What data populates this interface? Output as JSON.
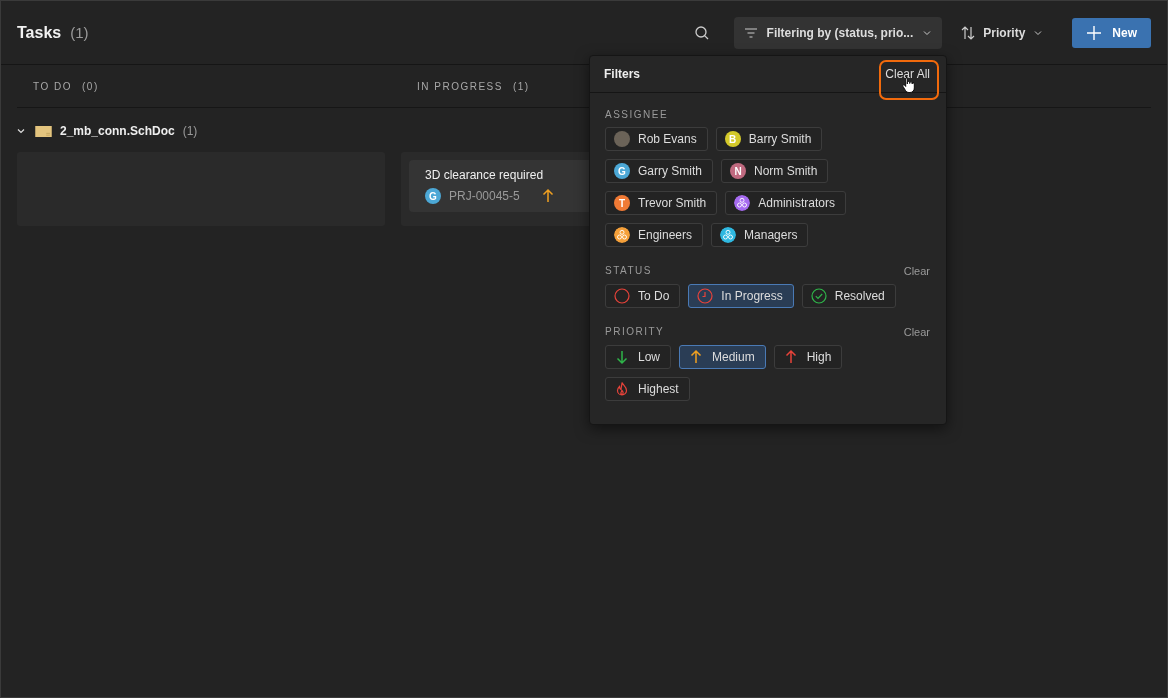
{
  "header": {
    "title": "Tasks",
    "count": "(1)",
    "filter_label": "Filtering by (status, prio...",
    "sort_label": "Priority",
    "new_label": "New"
  },
  "columns": [
    {
      "title": "TO DO",
      "count": "(0)"
    },
    {
      "title": "IN PROGRESS",
      "count": "(1)",
      "cards": [
        {
          "title": "3D clearance required",
          "assignee": {
            "letter": "G",
            "color": "#4ca8d6"
          },
          "id": "PRJ-00045-5",
          "priority": {
            "kind": "medium"
          }
        }
      ]
    }
  ],
  "group": {
    "name": "2_mb_conn.SchDoc",
    "count": "(1)",
    "expanded": true
  },
  "filters": {
    "title": "Filters",
    "clear_all": "Clear All",
    "assignee": {
      "heading": "ASSIGNEE",
      "items": [
        {
          "kind": "photo",
          "label": "Rob Evans",
          "selected": false
        },
        {
          "kind": "letter",
          "letter": "B",
          "color": "#d4c92a",
          "label": "Barry Smith",
          "selected": false
        },
        {
          "kind": "letter",
          "letter": "G",
          "color": "#4ca8d6",
          "label": "Garry Smith",
          "selected": false
        },
        {
          "kind": "letter",
          "letter": "N",
          "color": "#c06a80",
          "label": "Norm Smith",
          "selected": false
        },
        {
          "kind": "letter",
          "letter": "T",
          "color": "#f07a35",
          "label": "Trevor Smith",
          "selected": false
        },
        {
          "kind": "group",
          "color": "#a66bf0",
          "label": "Administrators",
          "selected": false
        },
        {
          "kind": "group",
          "color": "#f5a03a",
          "label": "Engineers",
          "selected": false
        },
        {
          "kind": "group",
          "color": "#2fb8e0",
          "label": "Managers",
          "selected": false
        }
      ]
    },
    "status": {
      "heading": "STATUS",
      "clear": "Clear",
      "items": [
        {
          "kind": "todo",
          "label": "To Do",
          "selected": false
        },
        {
          "kind": "progress",
          "label": "In Progress",
          "selected": true
        },
        {
          "kind": "resolved",
          "label": "Resolved",
          "selected": false
        }
      ]
    },
    "priority": {
      "heading": "PRIORITY",
      "clear": "Clear",
      "items": [
        {
          "kind": "low",
          "label": "Low",
          "selected": false
        },
        {
          "kind": "medium",
          "label": "Medium",
          "selected": true
        },
        {
          "kind": "high",
          "label": "High",
          "selected": false
        },
        {
          "kind": "highest",
          "label": "Highest",
          "selected": false
        }
      ]
    }
  }
}
